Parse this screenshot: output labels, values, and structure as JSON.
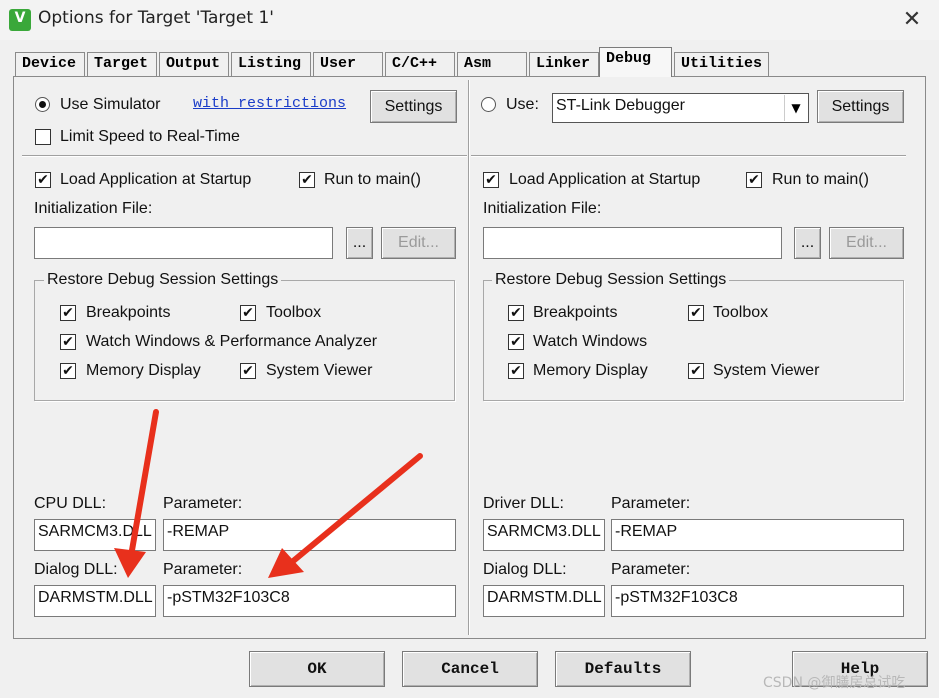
{
  "window": {
    "title": "Options for Target 'Target 1'",
    "icon_name": "keil-uvision-icon",
    "close_glyph": "✕"
  },
  "tabs": [
    "Device",
    "Target",
    "Output",
    "Listing",
    "User",
    "C/C++",
    "Asm",
    "Linker",
    "Debug",
    "Utilities"
  ],
  "active_tab": "Debug",
  "left": {
    "use_simulator_label": "Use Simulator",
    "use_simulator_selected": true,
    "restrictions_link": "with restrictions",
    "settings_label": "Settings",
    "limit_speed_label": "Limit Speed to Real-Time",
    "limit_speed_checked": false,
    "load_app_label": "Load Application at Startup",
    "load_app_checked": true,
    "run_to_main_label": "Run to main()",
    "run_to_main_checked": true,
    "init_file_label": "Initialization File:",
    "init_file_value": "",
    "browse_label": "...",
    "edit_label": "Edit...",
    "restore_group_title": "Restore Debug Session Settings",
    "restore": {
      "breakpoints": "Breakpoints",
      "toolbox": "Toolbox",
      "watch": "Watch Windows & Performance Analyzer",
      "memory": "Memory Display",
      "system_viewer": "System Viewer"
    },
    "cpu_dll_label": "CPU DLL:",
    "cpu_param_label": "Parameter:",
    "cpu_dll_value": "SARMCM3.DLL",
    "cpu_param_value": "-REMAP",
    "dialog_dll_label": "Dialog DLL:",
    "dialog_param_label": "Parameter:",
    "dialog_dll_value": "DARMSTM.DLL",
    "dialog_param_value": "-pSTM32F103C8"
  },
  "right": {
    "use_label": "Use:",
    "use_selected": false,
    "debugger_value": "ST-Link Debugger",
    "settings_label": "Settings",
    "load_app_label": "Load Application at Startup",
    "load_app_checked": true,
    "run_to_main_label": "Run to main()",
    "run_to_main_checked": true,
    "init_file_label": "Initialization File:",
    "init_file_value": "",
    "browse_label": "...",
    "edit_label": "Edit...",
    "restore_group_title": "Restore Debug Session Settings",
    "restore": {
      "breakpoints": "Breakpoints",
      "toolbox": "Toolbox",
      "watch": "Watch Windows",
      "memory": "Memory Display",
      "system_viewer": "System Viewer"
    },
    "driver_dll_label": "Driver DLL:",
    "driver_param_label": "Parameter:",
    "driver_dll_value": "SARMCM3.DLL",
    "driver_param_value": "-REMAP",
    "dialog_dll_label": "Dialog DLL:",
    "dialog_param_label": "Parameter:",
    "dialog_dll_value": "DARMSTM.DLL",
    "dialog_param_value": "-pSTM32F103C8"
  },
  "footer": {
    "ok": "OK",
    "cancel": "Cancel",
    "defaults": "Defaults",
    "help": "Help"
  },
  "watermark": "CSDN @御膳房总试吃",
  "annotation_color": "#e8301c"
}
